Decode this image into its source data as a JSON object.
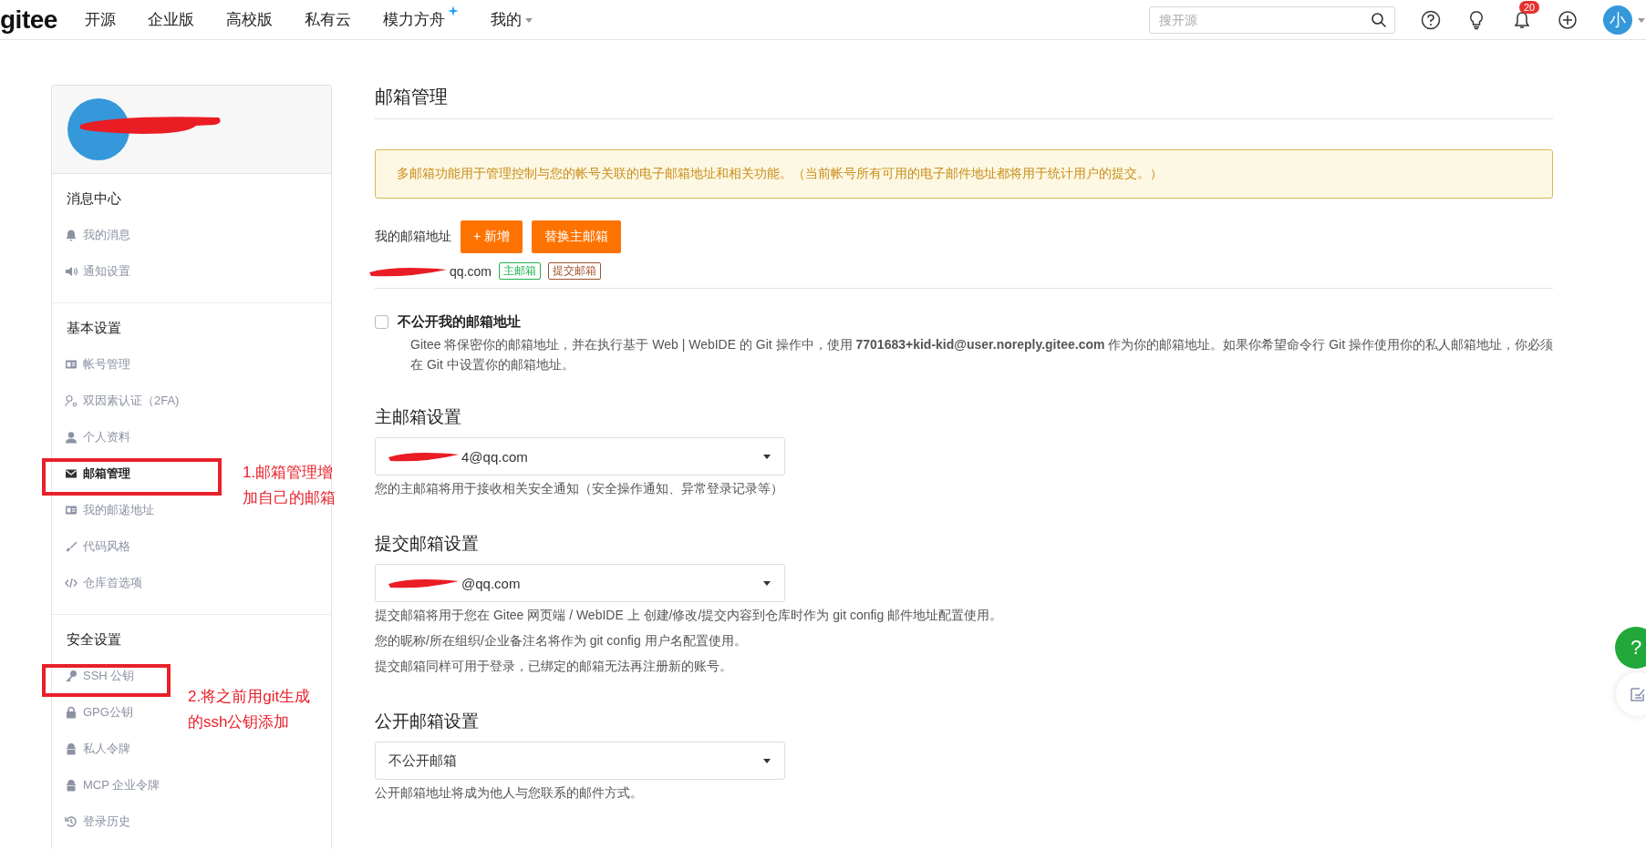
{
  "header": {
    "logo": "gitee",
    "nav": [
      {
        "label": "开源",
        "kind": "plain"
      },
      {
        "label": "企业版",
        "kind": "plain"
      },
      {
        "label": "高校版",
        "kind": "plain"
      },
      {
        "label": "私有云",
        "kind": "plain"
      },
      {
        "label": "模力方舟",
        "kind": "sparkle"
      },
      {
        "label": "我的",
        "kind": "dropdown"
      }
    ],
    "search": {
      "placeholder": "搜开源"
    },
    "notification_badge": "20",
    "avatar": "小"
  },
  "sidebar": {
    "sections": [
      {
        "title": "消息中心",
        "items": [
          {
            "label": "我的消息",
            "selected": false
          },
          {
            "label": "通知设置",
            "selected": false
          }
        ]
      },
      {
        "title": "基本设置",
        "items": [
          {
            "label": "帐号管理",
            "selected": false
          },
          {
            "label": "双因素认证（2FA)",
            "selected": false
          },
          {
            "label": "个人资料",
            "selected": false
          },
          {
            "label": "邮箱管理",
            "selected": true
          },
          {
            "label": "我的邮递地址",
            "selected": false
          },
          {
            "label": "代码风格",
            "selected": false
          },
          {
            "label": "仓库首选项",
            "selected": false
          }
        ]
      },
      {
        "title": "安全设置",
        "items": [
          {
            "label": "SSH 公钥",
            "selected": false
          },
          {
            "label": "GPG公钥",
            "selected": false
          },
          {
            "label": "私人令牌",
            "selected": false
          },
          {
            "label": "MCP 企业令牌",
            "selected": false
          },
          {
            "label": "登录历史",
            "selected": false
          }
        ]
      }
    ]
  },
  "main": {
    "title": "邮箱管理",
    "notice": "多邮箱功能用于管理控制与您的帐号关联的电子邮箱地址和相关功能。（当前帐号所有可用的电子邮件地址都将用于统计用户的提交。）",
    "my_emails": {
      "label": "我的邮箱地址",
      "buttons": [
        "+ 新增",
        "替换主邮箱"
      ],
      "address": "qq.com",
      "tags": [
        {
          "label": "主邮箱",
          "color": "#21b351"
        },
        {
          "label": "提交邮箱",
          "color": "#a0522d"
        }
      ]
    },
    "privacy": {
      "label": "不公开我的邮箱地址",
      "checked": false,
      "description": "Gitee 将保密你的邮箱地址，并在执行基于 Web | WebIDE 的 Git 操作中，使用 **7701683+kid-kid@user.noreply.gitee.com** 作为你的邮箱地址。如果你希望命令行 Git 操作使用你的私人邮箱地址，你必须在 Git 中设置你的邮箱地址。"
    },
    "settings": [
      {
        "heading": "主邮箱设置",
        "value": "4@qq.com",
        "redacted": true,
        "notes": [
          "您的主邮箱将用于接收相关安全通知（安全操作通知、异常登录记录等）"
        ]
      },
      {
        "heading": "提交邮箱设置",
        "value": "@qq.com",
        "redacted": true,
        "notes": [
          "提交邮箱将用于您在 Gitee 网页端 / WebIDE 上 创建/修改/提交内容到仓库时作为 git config 邮件地址配置使用。",
          "您的昵称/所在组织/企业备注名将作为 git config 用户名配置使用。",
          "提交邮箱同样可用于登录，已绑定的邮箱无法再注册新的账号。"
        ]
      },
      {
        "heading": "公开邮箱设置",
        "value": "不公开邮箱",
        "redacted": false,
        "notes": [
          "公开邮箱地址将成为他人与您联系的邮件方式。"
        ]
      }
    ]
  },
  "floating": {
    "help": "?"
  },
  "annotations": [
    "1.邮箱管理增加自己的邮箱",
    "2.将之前用git生成的ssh公钥添加"
  ]
}
